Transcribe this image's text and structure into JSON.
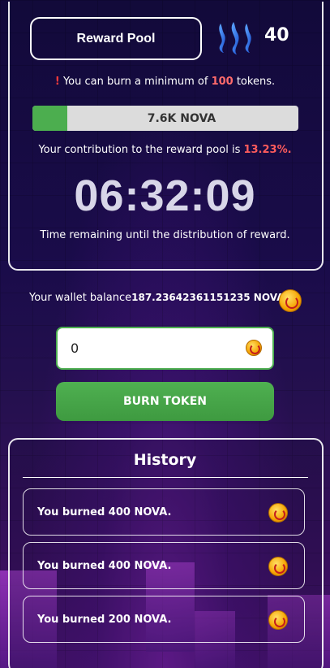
{
  "header": {
    "reward_pool_label": "Reward Pool",
    "steem_icon": "steem-logo-icon",
    "steem_count": "40"
  },
  "notice": {
    "exclamation": "!",
    "prefix": " You can burn a minimum of ",
    "min_amount": "100",
    "suffix": " tokens."
  },
  "progress": {
    "label": "7.6K NOVA",
    "fill_fraction": 0.1323,
    "fill_color": "#4cae4f"
  },
  "contribution": {
    "prefix": "Your contribution to the reward pool is ",
    "percent": "13.23%."
  },
  "timer": {
    "value": "06:32:09",
    "label": "Time remaining until the distribution of reward."
  },
  "wallet": {
    "label": "Your wallet balance",
    "balance": "187.23642361151235 NOVA",
    "coin_icon": "nova-coin-icon"
  },
  "burn": {
    "input_value": "0",
    "button_label": "BURN TOKEN"
  },
  "history": {
    "title": "History",
    "items": [
      {
        "text": "You burned 400 NOVA."
      },
      {
        "text": "You burned 400 NOVA."
      },
      {
        "text": "You burned 200 NOVA."
      }
    ]
  },
  "colors": {
    "accent_green": "#4cae4f",
    "highlight_red": "#ff5c5c",
    "background": "#140a3a"
  }
}
